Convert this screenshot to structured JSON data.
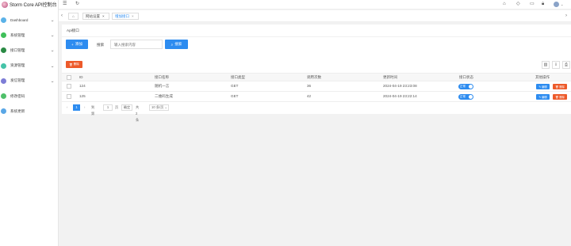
{
  "app": {
    "title": "Storm Core API控制台"
  },
  "sidebar": {
    "items": [
      {
        "label": "Dashboard",
        "color": "#5bb2e8",
        "icon": "dashboard-icon"
      },
      {
        "label": "系统管理",
        "color": "#3fbf5a",
        "icon": "system-icon"
      },
      {
        "label": "接口管理",
        "color": "#2a8a44",
        "icon": "api-icon"
      },
      {
        "label": "资源管理",
        "color": "#45c3a8",
        "icon": "resource-icon"
      },
      {
        "label": "发信管理",
        "color": "#7d7dd6",
        "icon": "send-icon"
      },
      {
        "label": "修改密码",
        "color": "#4fc06a",
        "icon": "password-icon"
      },
      {
        "label": "系统更新",
        "color": "#5aa7e6",
        "icon": "update-icon"
      }
    ]
  },
  "tabs": [
    {
      "label": "网站设置",
      "active": false
    },
    {
      "label": "增加接口",
      "active": true
    }
  ],
  "card": {
    "title": "Api接口"
  },
  "toolbar": {
    "add_label": "添加",
    "search_label": "搜索",
    "search_placeholder": "输入搜索内容",
    "search_button": "搜索",
    "delete_label": "删除"
  },
  "table": {
    "headers": [
      "ID",
      "接口名称",
      "接口类型",
      "调用次数",
      "更新时间",
      "接口状态",
      "其他操作"
    ],
    "rows": [
      {
        "id": "124",
        "name": "随机一言",
        "type": "GET",
        "calls": "36",
        "updated": "2024-04-19 23:23:08",
        "status": "正常"
      },
      {
        "id": "125",
        "name": "二维码生成",
        "type": "GET",
        "calls": "42",
        "updated": "2024-04-19 23:22:14",
        "status": "正常"
      }
    ],
    "edit_label": "编辑",
    "delete_label": "删除"
  },
  "pager": {
    "prev": "‹",
    "page": "1",
    "next": "›",
    "goto_label": "到第",
    "goto_value": "1",
    "page_unit": "页",
    "confirm": "确定",
    "total": "共 2 条",
    "per_page": "10 条/页"
  }
}
